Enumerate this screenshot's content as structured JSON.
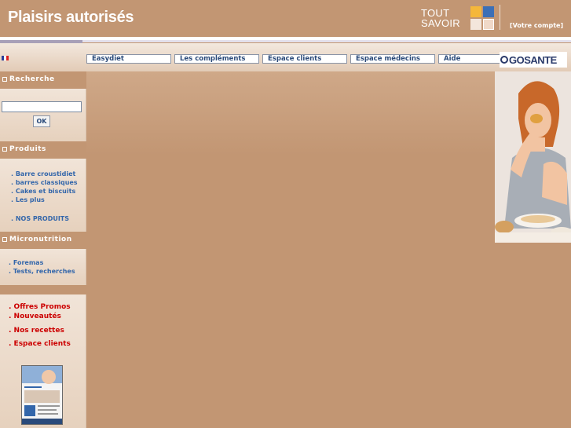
{
  "header": {
    "title": "Plaisirs autorisés",
    "tout_line1": "TOUT",
    "tout_line2": "SAVOIR",
    "account_link": "[Votre compte]",
    "square_colors": [
      "#f5b73a",
      "#3c6fb6",
      "#f3e6dc",
      "#f0d9c8"
    ]
  },
  "language": {
    "flag_colors": [
      "#2b3e99",
      "#ffffff",
      "#dd2222"
    ]
  },
  "nav": {
    "tabs": [
      "Easydiet",
      "Les compléments",
      "Espace clients",
      "Espace médecins",
      "Aide"
    ]
  },
  "logo": {
    "text": "GOSANTE"
  },
  "sidebar": {
    "search": {
      "heading": "Recherche",
      "input_value": "",
      "button": "OK"
    },
    "products": {
      "heading": "Produits",
      "items": [
        ". Barre croustidiet",
        ". barres classiques",
        ". Cakes et biscuits",
        ". Les plus"
      ],
      "all": ". NOS PRODUITS"
    },
    "micro": {
      "heading": "Micronutrition",
      "items": [
        ". Foremas",
        ". Tests, recherches"
      ]
    },
    "extra": {
      "items": [
        ". Offres Promos",
        ". Nouveautés",
        ". Nos recettes",
        ". Espace clients"
      ]
    }
  },
  "colors": {
    "background": "#c29673",
    "link": "#3366aa",
    "promo": "#cc0000",
    "nav_text": "#2a4a7a"
  }
}
